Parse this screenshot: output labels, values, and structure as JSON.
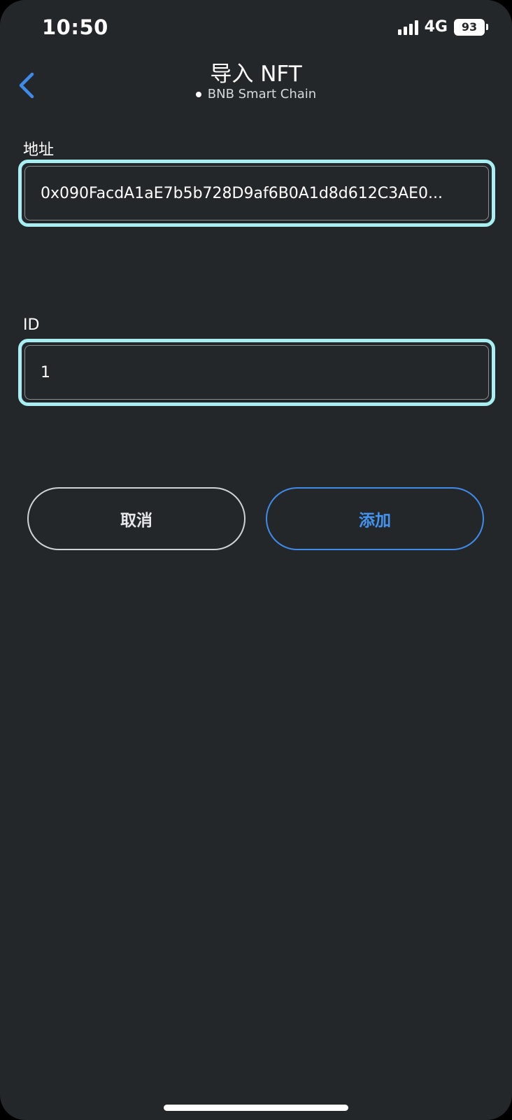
{
  "status_bar": {
    "time": "10:50",
    "network": "4G",
    "battery": "93"
  },
  "header": {
    "title": "导入 NFT",
    "network_name": "BNB Smart Chain"
  },
  "form": {
    "address_label": "地址",
    "address_value": "0x090FacdA1aE7b5b728D9af6B0A1d8d612C3AE0...",
    "id_label": "ID",
    "id_value": "1"
  },
  "buttons": {
    "cancel_label": "取消",
    "add_label": "添加"
  },
  "colors": {
    "background": "#24272a",
    "focus_ring": "#a8eef2",
    "accent": "#4493ee"
  },
  "icons": {
    "back": "chevron-left-icon",
    "signal": "signal-bars-icon",
    "battery": "battery-icon"
  }
}
